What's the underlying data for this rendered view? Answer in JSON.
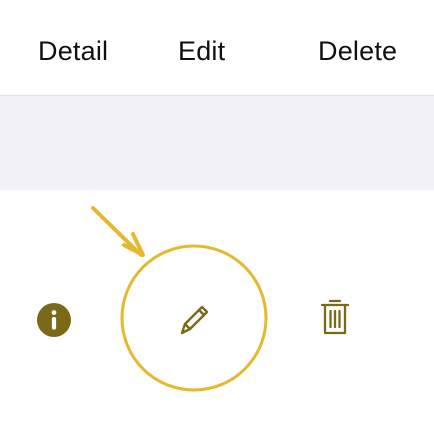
{
  "top_actions": {
    "detail_label": "Detail",
    "edit_label": "Edit",
    "delete_label": "Delete"
  },
  "icons": {
    "detail": "info-icon",
    "edit": "pencil-icon",
    "delete": "trash-icon"
  },
  "colors": {
    "accent_gold": "#E5B92B",
    "icon_dark": "#7A6A18",
    "divider_band": "#F2F2F4"
  }
}
